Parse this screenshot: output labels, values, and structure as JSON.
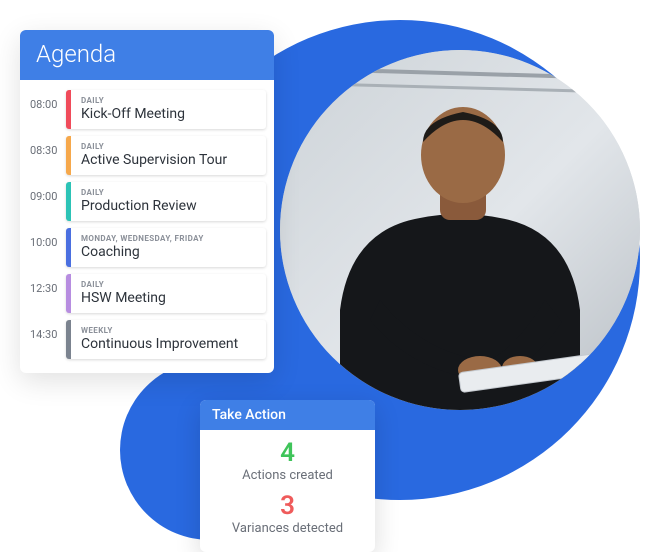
{
  "agenda": {
    "title": "Agenda",
    "items": [
      {
        "time": "08:00",
        "freq": "DAILY",
        "title": "Kick-Off Meeting",
        "color": "#f04b5a"
      },
      {
        "time": "08:30",
        "freq": "DAILY",
        "title": "Active Supervision Tour",
        "color": "#f6a84b"
      },
      {
        "time": "09:00",
        "freq": "DAILY",
        "title": "Production Review",
        "color": "#2cc3b6"
      },
      {
        "time": "10:00",
        "freq": "MONDAY, WEDNESDAY, FRIDAY",
        "title": "Coaching",
        "color": "#4a6fe0"
      },
      {
        "time": "12:30",
        "freq": "DAILY",
        "title": "HSW Meeting",
        "color": "#b78de0"
      },
      {
        "time": "14:30",
        "freq": "WEEKLY",
        "title": "Continuous Improvement",
        "color": "#7b838f"
      }
    ]
  },
  "take_action": {
    "title": "Take Action",
    "metrics": [
      {
        "value": "4",
        "label": "Actions created",
        "color": "green"
      },
      {
        "value": "3",
        "label": "Variances detected",
        "color": "red"
      }
    ]
  }
}
